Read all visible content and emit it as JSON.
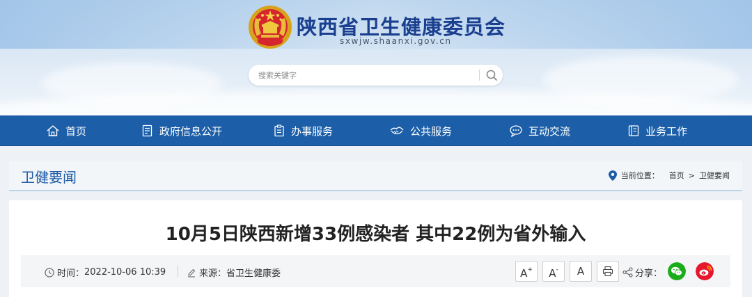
{
  "header": {
    "site_title": "陕西省卫生健康委员会",
    "site_domain": "sxwjw.shaanxi.gov.cn",
    "search_placeholder": "搜索关键字"
  },
  "nav": {
    "items": [
      {
        "label": "首页",
        "icon": "home-icon"
      },
      {
        "label": "政府信息公开",
        "icon": "document-list-icon"
      },
      {
        "label": "办事服务",
        "icon": "clipboard-icon"
      },
      {
        "label": "公共服务",
        "icon": "handshake-icon"
      },
      {
        "label": "互动交流",
        "icon": "chat-bubble-icon"
      },
      {
        "label": "业务工作",
        "icon": "book-icon"
      }
    ]
  },
  "section": {
    "title": "卫健要闻",
    "location_label": "当前位置：",
    "breadcrumb": [
      "首页",
      "卫健要闻"
    ],
    "separator": ">"
  },
  "article": {
    "headline": "10月5日陕西新增33例感染者 其中22例为省外输入",
    "time_label": "时间：",
    "time_value": "2022-10-06 10:39",
    "source_label": "来源：",
    "source_value": "省卫生健康委",
    "font_buttons": {
      "increase": "A",
      "decrease": "A",
      "reset": "A",
      "increase_sup": "+",
      "decrease_sup": "-"
    },
    "share_label": "分享："
  },
  "colors": {
    "nav_bg": "#1c5fa8",
    "title_blue": "#1a3f8f",
    "section_blue": "#1d5ba6",
    "wechat_green": "#1aad19",
    "weibo_red": "#e6162d"
  }
}
